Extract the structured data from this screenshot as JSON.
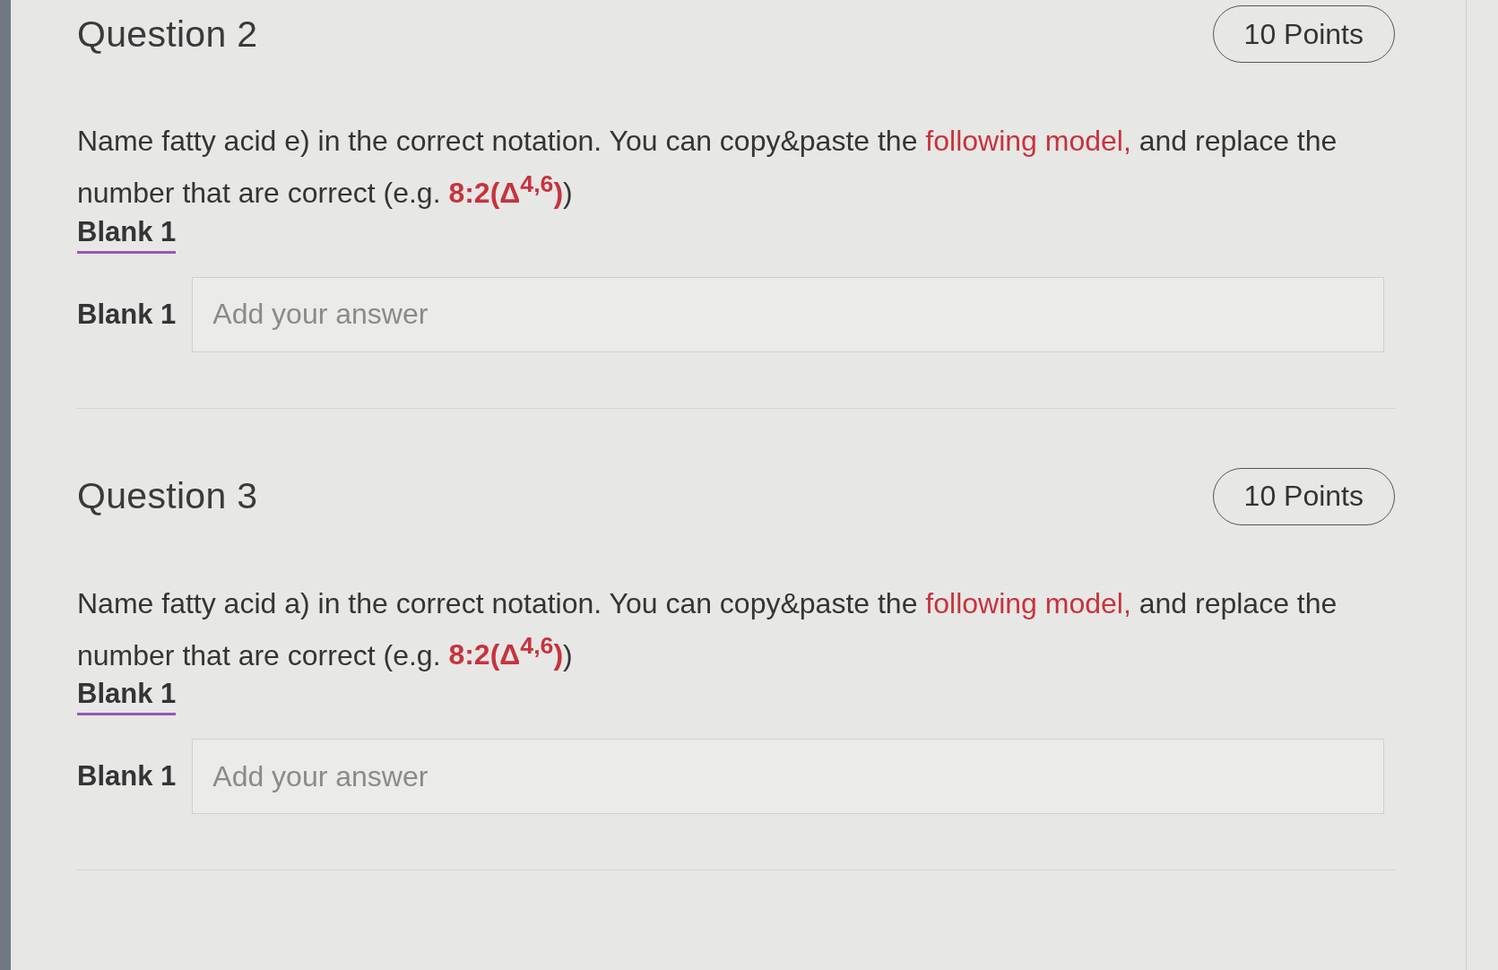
{
  "questions": [
    {
      "title": "Question 2",
      "points": "10 Points",
      "text": [
        {
          "text": "Name fatty acid e) in the correct notation. You can copy&paste the "
        },
        {
          "text": "following model,",
          "color": "#c8323c"
        },
        {
          "text": " and replace the number that are correct (e.g. "
        },
        {
          "text": "**8:2(Δ$^{4,6}$)**",
          "color": "#c8323c"
        },
        {
          "text": ")"
        }
      ],
      "blank_heading": "Blank 1",
      "blanks": [
        {
          "label": "Blank 1",
          "placeholder": "Add your answer"
        }
      ]
    },
    {
      "title": "Question 3",
      "points": "10 Points",
      "text": [
        {
          "text": "Name fatty acid a) in the correct notation. You can copy&paste the "
        },
        {
          "text": "following model,",
          "color": "#c8323c"
        },
        {
          "text": " and replace the number that are correct (e.g. "
        },
        {
          "text": "**8:2(Δ$^{4,6}$)**",
          "color": "#c8323c"
        },
        {
          "text": ")"
        }
      ],
      "blank_heading": "Blank 1",
      "blanks": [
        {
          "label": "Blank 1",
          "placeholder": "Add your answer"
        }
      ]
    }
  ]
}
